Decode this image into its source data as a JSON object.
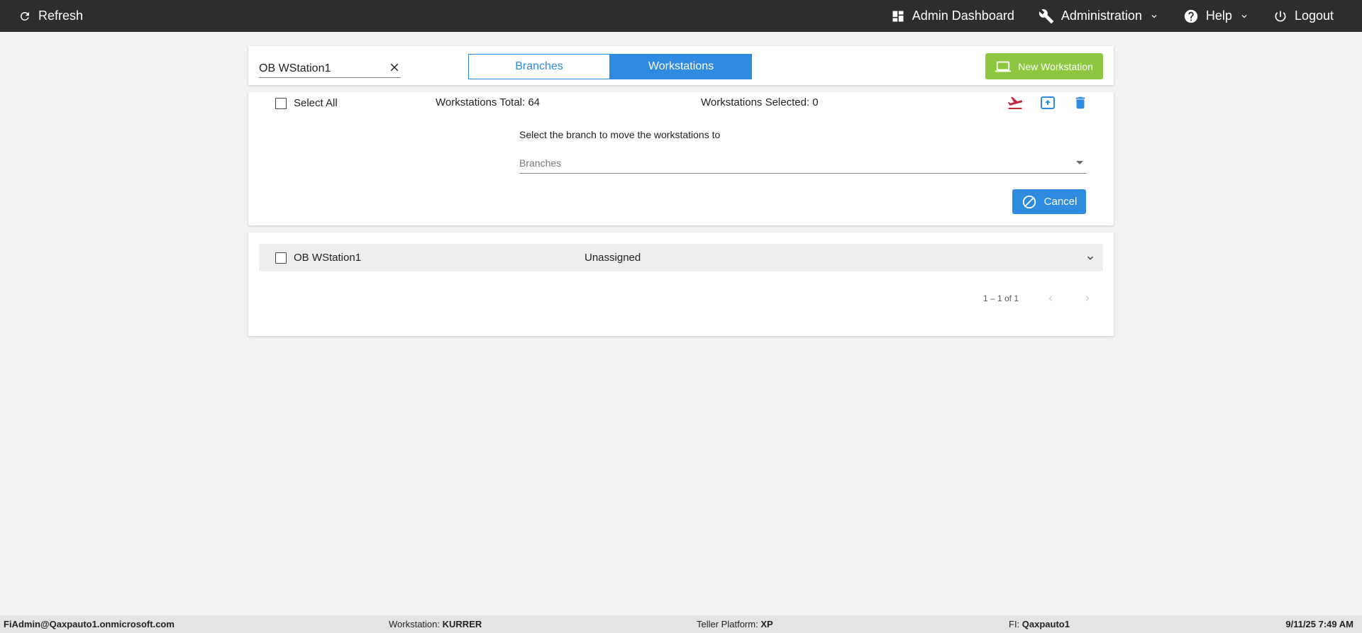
{
  "topbar": {
    "refresh_label": "Refresh",
    "admin_dashboard_label": "Admin Dashboard",
    "administration_label": "Administration",
    "help_label": "Help",
    "logout_label": "Logout"
  },
  "search": {
    "value": "OB WStation1"
  },
  "tabs": {
    "branches_label": "Branches",
    "workstations_label": "Workstations",
    "active": "workstations"
  },
  "new_workstation_label": "New Workstation",
  "actions": {
    "select_all_label": "Select All",
    "total_text": "Workstations Total: 64",
    "selected_text": "Workstations Selected: 0",
    "move_label": "Select the branch to move the workstations to",
    "branch_placeholder": "Branches",
    "cancel_label": "Cancel"
  },
  "rows": [
    {
      "name": "OB WStation1",
      "status": "Unassigned"
    }
  ],
  "pager": {
    "text": "1 – 1 of 1"
  },
  "statusbar": {
    "user": "FiAdmin@Qaxpauto1.onmicrosoft.com",
    "workstation_label": "Workstation:",
    "workstation_value": "KURRER",
    "platform_label": "Teller Platform:",
    "platform_value": "XP",
    "fi_label": "FI:",
    "fi_value": "Qaxpauto1",
    "datetime": "9/11/25 7:49 AM"
  },
  "colors": {
    "topbar": "#2d2d2d",
    "primary_blue": "#2f8be0",
    "green": "#8dc63f",
    "danger_red": "#c0273d"
  }
}
